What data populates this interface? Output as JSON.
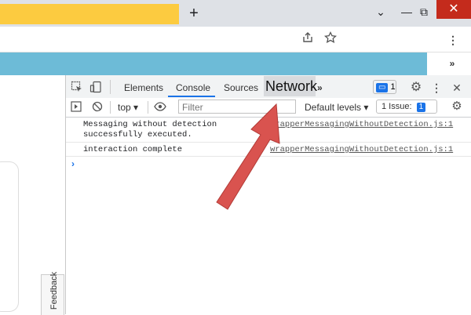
{
  "browser": {
    "new_tab": "+",
    "win_min": "—",
    "win_restore": "⧉",
    "win_close": "✕",
    "win_chevron": "⌄",
    "toolbar_more": "»"
  },
  "devtools": {
    "tabs": [
      "Elements",
      "Console",
      "Sources",
      "Network"
    ],
    "more_tabs": "»",
    "messages_badge": "1",
    "context": "top ▾",
    "filter_placeholder": "Filter",
    "levels": "Default levels ▾",
    "issues_label": "1 Issue:",
    "issues_badge": "1",
    "logs": [
      {
        "text": "Messaging without detection\nsuccessfully executed.",
        "source": "wrapperMessagingWithoutDetection.js:1"
      },
      {
        "text": "interaction complete",
        "source": "wrapperMessagingWithoutDetection.js:1"
      }
    ],
    "prompt": "›"
  },
  "side": {
    "feedback": "Feedback"
  },
  "colors": {
    "tab_yellow": "#fccb40",
    "blue_bar": "#6dbbd7",
    "accent": "#1a73e8",
    "arrow": "#d9534f"
  }
}
